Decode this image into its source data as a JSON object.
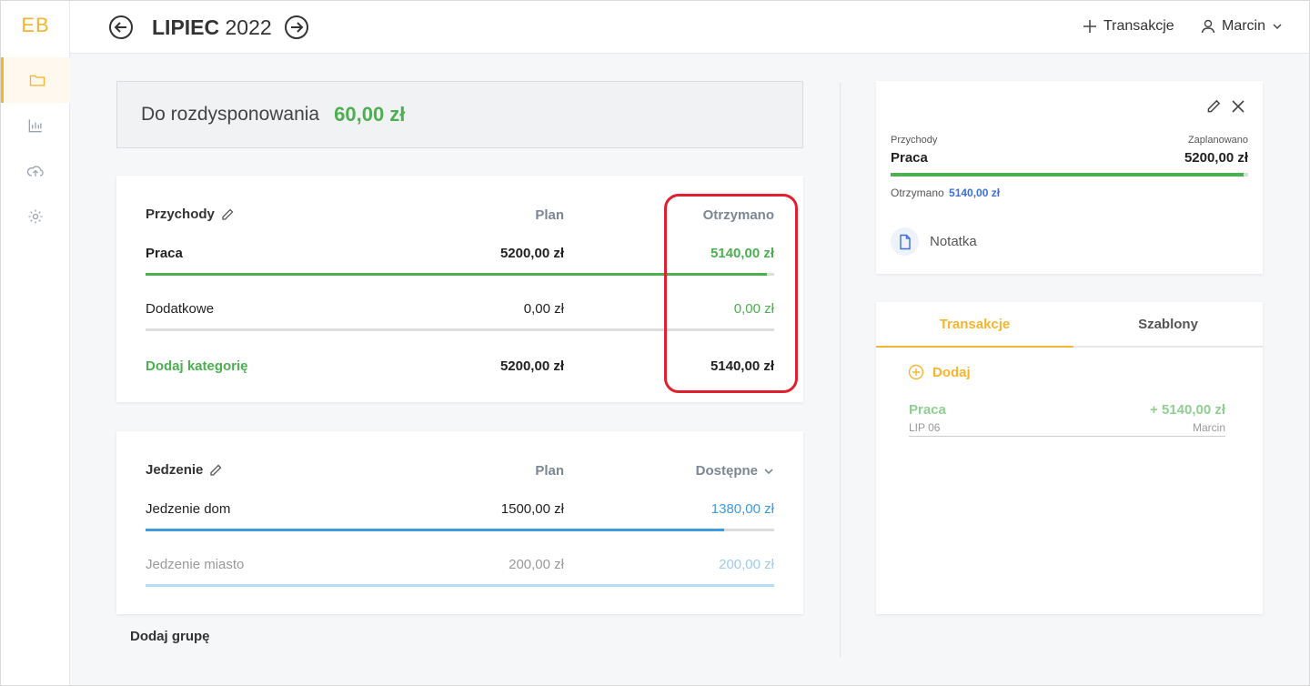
{
  "app": {
    "logo": "EB"
  },
  "sidebar": {
    "items": [
      {
        "icon": "folder-icon",
        "active": true
      },
      {
        "icon": "chart-icon",
        "active": false
      },
      {
        "icon": "cloud-upload-icon",
        "active": false
      },
      {
        "icon": "gear-icon",
        "active": false
      }
    ]
  },
  "header": {
    "month": "LIPIEC",
    "year": "2022",
    "add_transaction": "Transakcje",
    "user": "Marcin"
  },
  "summary": {
    "label": "Do rozdysponowania",
    "value": "60,00 zł"
  },
  "income": {
    "title": "Przychody",
    "col_plan": "Plan",
    "col_received": "Otrzymano",
    "rows": [
      {
        "label": "Praca",
        "plan": "5200,00 zł",
        "received": "5140,00 zł",
        "progress": 0.988
      },
      {
        "label": "Dodatkowe",
        "plan": "0,00 zł",
        "received": "0,00 zł",
        "progress": 0
      }
    ],
    "add_category": "Dodaj kategorię",
    "total_plan": "5200,00 zł",
    "total_received": "5140,00 zł"
  },
  "food": {
    "title": "Jedzenie",
    "col_plan": "Plan",
    "col_available": "Dostępne",
    "rows": [
      {
        "label": "Jedzenie dom",
        "plan": "1500,00 zł",
        "available": "1380,00 zł",
        "progress": 0.92
      },
      {
        "label": "Jedzenie miasto",
        "plan": "200,00 zł",
        "available": "200,00 zł",
        "progress": 1.0
      }
    ]
  },
  "add_group": "Dodaj grupę",
  "detail": {
    "category_group": "Przychody",
    "category": "Praca",
    "planned_label": "Zaplanowano",
    "planned_value": "5200,00 zł",
    "received_label": "Otrzymano",
    "received_value": "5140,00 zł",
    "progress": 0.988,
    "note_label": "Notatka"
  },
  "tabs": {
    "transactions": "Transakcje",
    "templates": "Szablony",
    "add_label": "Dodaj",
    "items": [
      {
        "name": "Praca",
        "amount": "+ 5140,00 zł",
        "date": "LIP 06",
        "user": "Marcin"
      }
    ]
  },
  "colors": {
    "accent": "#f5b52e",
    "income_green": "#4caf50",
    "blue": "#3d9be0",
    "highlight_red": "#e0202e"
  }
}
